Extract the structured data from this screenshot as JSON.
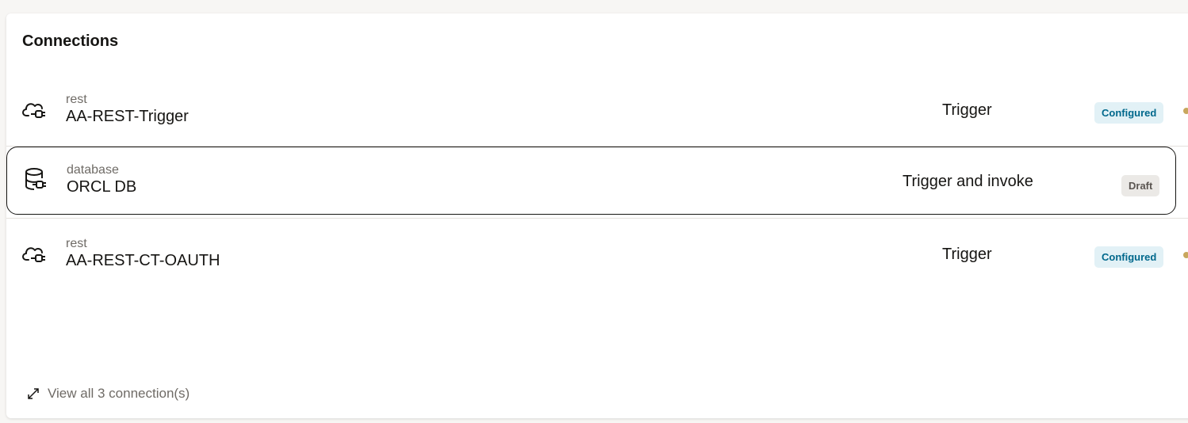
{
  "panel": {
    "title": "Connections"
  },
  "connections": [
    {
      "type": "rest",
      "name": "AA-REST-Trigger",
      "role": "Trigger",
      "status": "Configured",
      "icon": "cloud-plug-icon"
    },
    {
      "type": "database",
      "name": "ORCL DB",
      "role": "Trigger and invoke",
      "status": "Draft",
      "icon": "database-plug-icon"
    },
    {
      "type": "rest",
      "name": "AA-REST-CT-OAUTH",
      "role": "Trigger",
      "status": "Configured",
      "icon": "cloud-plug-icon"
    }
  ],
  "footer": {
    "view_all_label": "View all 3 connection(s)",
    "icon": "expand-icon"
  },
  "colors": {
    "configured_bg": "#e2f1f6",
    "configured_text": "#00688c",
    "draft_bg": "#ebe9e6",
    "draft_text": "#5b5652",
    "text_primary": "#161513",
    "text_secondary": "#6f6b66"
  }
}
